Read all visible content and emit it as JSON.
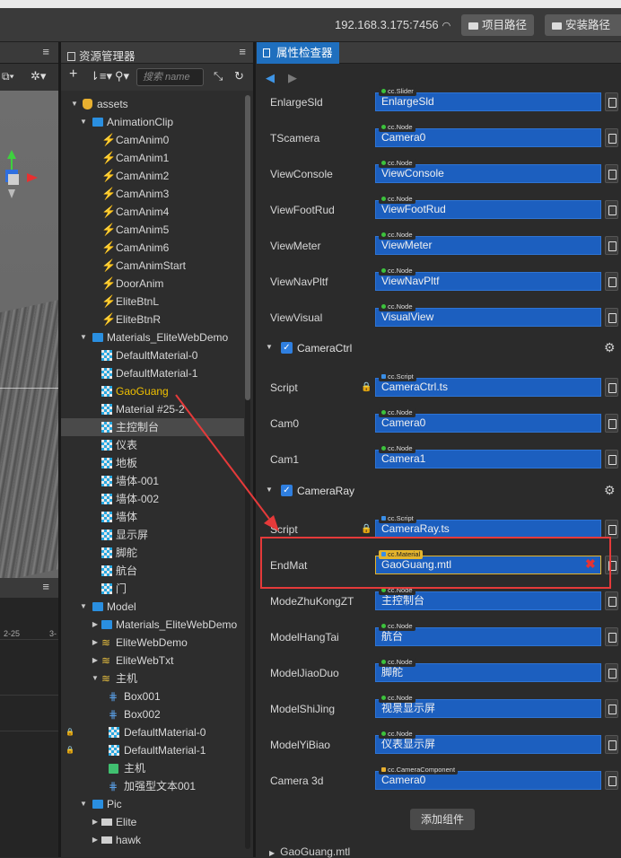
{
  "topbar": {
    "ip": "192.168.3.175:7456",
    "project_path": "项目路径",
    "install_path": "安装路径"
  },
  "assets_panel": {
    "title": "资源管理器",
    "search_placeholder": "搜索 name",
    "tree": [
      {
        "label": "assets",
        "depth": 0,
        "icon": "db-icon",
        "arrow": "▼"
      },
      {
        "label": "AnimationClip",
        "depth": 1,
        "icon": "folder-icon",
        "arrow": "▼"
      },
      {
        "label": "CamAnim0",
        "depth": 2,
        "icon": "anim-icon"
      },
      {
        "label": "CamAnim1",
        "depth": 2,
        "icon": "anim-icon"
      },
      {
        "label": "CamAnim2",
        "depth": 2,
        "icon": "anim-icon"
      },
      {
        "label": "CamAnim3",
        "depth": 2,
        "icon": "anim-icon"
      },
      {
        "label": "CamAnim4",
        "depth": 2,
        "icon": "anim-icon"
      },
      {
        "label": "CamAnim5",
        "depth": 2,
        "icon": "anim-icon"
      },
      {
        "label": "CamAnim6",
        "depth": 2,
        "icon": "anim-icon"
      },
      {
        "label": "CamAnimStart",
        "depth": 2,
        "icon": "anim-icon"
      },
      {
        "label": "DoorAnim",
        "depth": 2,
        "icon": "anim-icon"
      },
      {
        "label": "EliteBtnL",
        "depth": 2,
        "icon": "anim-icon"
      },
      {
        "label": "EliteBtnR",
        "depth": 2,
        "icon": "anim-icon"
      },
      {
        "label": "Materials_EliteWebDemo",
        "depth": 1,
        "icon": "folder-icon",
        "arrow": "▼"
      },
      {
        "label": "DefaultMaterial-0",
        "depth": 2,
        "icon": "material-icon"
      },
      {
        "label": "DefaultMaterial-1",
        "depth": 2,
        "icon": "material-icon"
      },
      {
        "label": "GaoGuang",
        "depth": 2,
        "icon": "material-icon",
        "highlight": true
      },
      {
        "label": "Material #25-2",
        "depth": 2,
        "icon": "material-icon"
      },
      {
        "label": "主控制台",
        "depth": 2,
        "icon": "material-icon",
        "selected": true
      },
      {
        "label": "仪表",
        "depth": 2,
        "icon": "material-icon"
      },
      {
        "label": "地板",
        "depth": 2,
        "icon": "material-icon"
      },
      {
        "label": "墙体-001",
        "depth": 2,
        "icon": "material-icon"
      },
      {
        "label": "墙体-002",
        "depth": 2,
        "icon": "material-icon"
      },
      {
        "label": "墙体",
        "depth": 2,
        "icon": "material-icon"
      },
      {
        "label": "显示屏",
        "depth": 2,
        "icon": "material-icon"
      },
      {
        "label": "脚舵",
        "depth": 2,
        "icon": "material-icon"
      },
      {
        "label": "航台",
        "depth": 2,
        "icon": "material-icon"
      },
      {
        "label": "门",
        "depth": 2,
        "icon": "material-icon"
      },
      {
        "label": "Model",
        "depth": 1,
        "icon": "folder-icon",
        "arrow": "▼"
      },
      {
        "label": "Materials_EliteWebDemo",
        "depth": 2,
        "icon": "folder-icon",
        "arrow": "▶"
      },
      {
        "label": "EliteWebDemo",
        "depth": 2,
        "icon": "stack-icon",
        "arrow": "▶"
      },
      {
        "label": "EliteWebTxt",
        "depth": 2,
        "icon": "stack-icon",
        "arrow": "▶"
      },
      {
        "label": "主机",
        "depth": 2,
        "icon": "stack-icon",
        "arrow": "▼"
      },
      {
        "label": "Box001",
        "depth": 3,
        "icon": "mesh-icon"
      },
      {
        "label": "Box002",
        "depth": 3,
        "icon": "mesh-icon"
      },
      {
        "label": "DefaultMaterial-0",
        "depth": 3,
        "icon": "material-icon",
        "locked": true
      },
      {
        "label": "DefaultMaterial-1",
        "depth": 3,
        "icon": "material-icon",
        "locked": true
      },
      {
        "label": "主机",
        "depth": 3,
        "icon": "prefab-icon"
      },
      {
        "label": "加强型文本001",
        "depth": 3,
        "icon": "mesh-icon"
      },
      {
        "label": "Pic",
        "depth": 1,
        "icon": "folder-icon",
        "arrow": "▼"
      },
      {
        "label": "Elite",
        "depth": 2,
        "icon": "image-icon",
        "arrow": "▶"
      },
      {
        "label": "hawk",
        "depth": 2,
        "icon": "image-icon",
        "arrow": "▶"
      }
    ]
  },
  "inspector": {
    "title": "属性检查器",
    "props_top": [
      {
        "label": "EnlargeSld",
        "type": "cc.Slider",
        "value": "EnlargeSld"
      },
      {
        "label": "TScamera",
        "type": "cc.Node",
        "value": "Camera0"
      },
      {
        "label": "ViewConsole",
        "type": "cc.Node",
        "value": "ViewConsole"
      },
      {
        "label": "ViewFootRud",
        "type": "cc.Node",
        "value": "ViewFootRud"
      },
      {
        "label": "ViewMeter",
        "type": "cc.Node",
        "value": "ViewMeter"
      },
      {
        "label": "ViewNavPltf",
        "type": "cc.Node",
        "value": "ViewNavPltf"
      },
      {
        "label": "ViewVisual",
        "type": "cc.Node",
        "value": "VisualView"
      }
    ],
    "camera_ctrl": {
      "name": "CameraCtrl",
      "props": [
        {
          "label": "Script",
          "type": "cc.Script",
          "value": "CameraCtrl.ts"
        },
        {
          "label": "Cam0",
          "type": "cc.Node",
          "value": "Camera0"
        },
        {
          "label": "Cam1",
          "type": "cc.Node",
          "value": "Camera1"
        }
      ]
    },
    "camera_ray": {
      "name": "CameraRay",
      "props": [
        {
          "label": "Script",
          "type": "cc.Script",
          "value": "CameraRay.ts"
        },
        {
          "label": "EndMat",
          "type": "cc.Material",
          "value": "GaoGuang.mtl"
        },
        {
          "label": "ModeZhuKongZT",
          "type": "cc.Node",
          "value": "主控制台"
        },
        {
          "label": "ModelHangTai",
          "type": "cc.Node",
          "value": "航台"
        },
        {
          "label": "ModelJiaoDuo",
          "type": "cc.Node",
          "value": "脚舵"
        },
        {
          "label": "ModelShiJing",
          "type": "cc.Node",
          "value": "视景显示屏"
        },
        {
          "label": "ModelYiBiao",
          "type": "cc.Node",
          "value": "仪表显示屏"
        },
        {
          "label": "Camera_3d",
          "type": "cc.CameraComponent",
          "value": "Camera0"
        }
      ]
    },
    "camera_3d_label": "Camera  3d",
    "add_component": "添加组件",
    "footer_asset": "GaoGuang.mtl"
  },
  "scene_ticks": {
    "a": "2-25",
    "b": "3-"
  }
}
